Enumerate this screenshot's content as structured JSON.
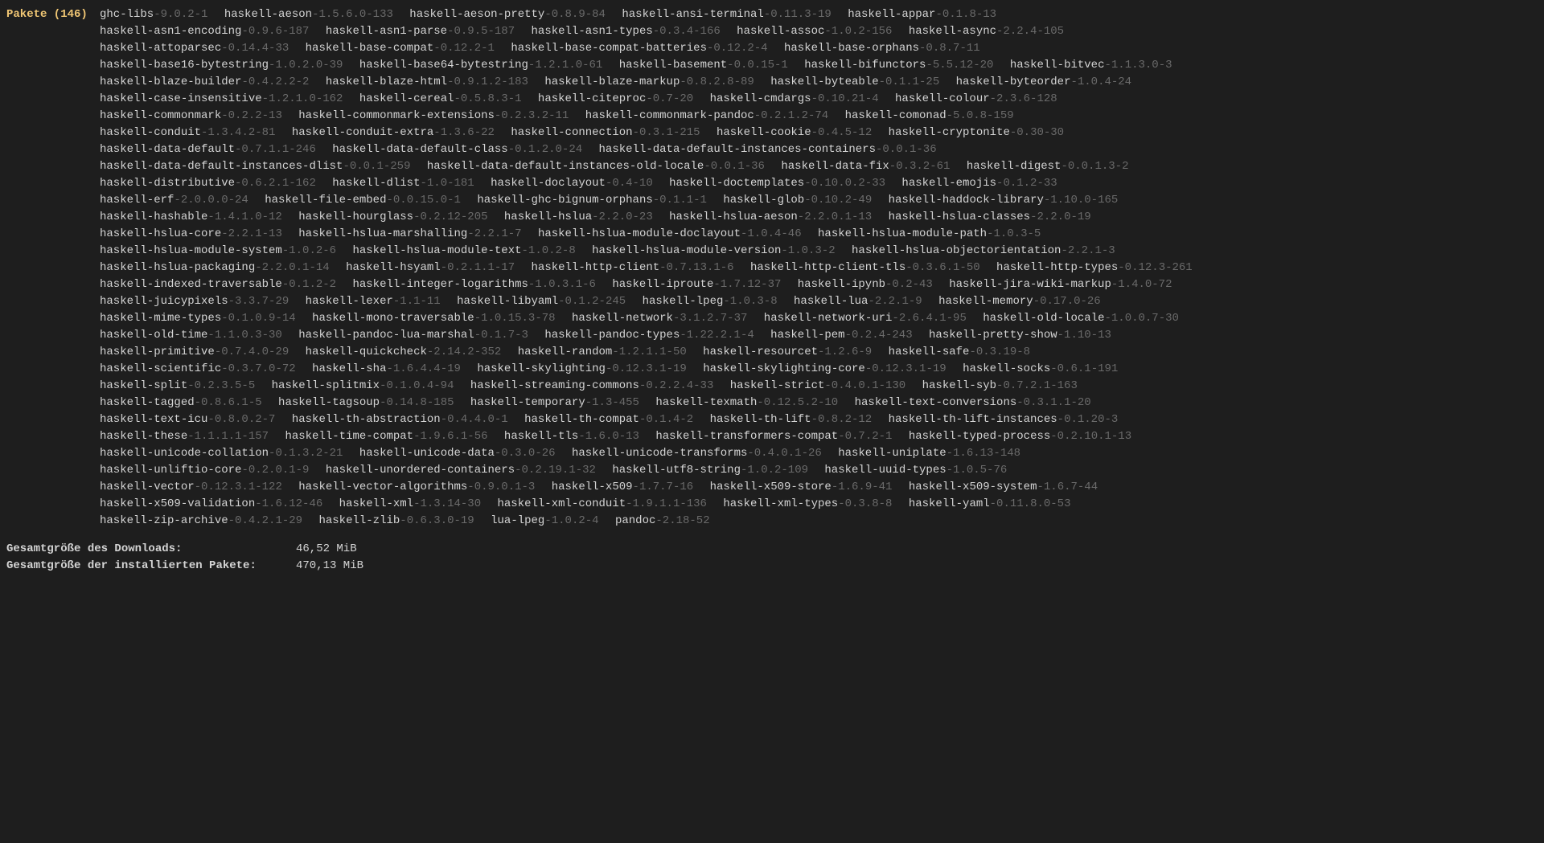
{
  "header": {
    "label": "Pakete",
    "count": "146"
  },
  "packages": [
    {
      "name": "ghc-libs",
      "ver": "9.0.2-1"
    },
    {
      "name": "haskell-aeson",
      "ver": "1.5.6.0-133"
    },
    {
      "name": "haskell-aeson-pretty",
      "ver": "0.8.9-84"
    },
    {
      "name": "haskell-ansi-terminal",
      "ver": "0.11.3-19"
    },
    {
      "name": "haskell-appar",
      "ver": "0.1.8-13"
    },
    {
      "name": "haskell-asn1-encoding",
      "ver": "0.9.6-187"
    },
    {
      "name": "haskell-asn1-parse",
      "ver": "0.9.5-187"
    },
    {
      "name": "haskell-asn1-types",
      "ver": "0.3.4-166"
    },
    {
      "name": "haskell-assoc",
      "ver": "1.0.2-156"
    },
    {
      "name": "haskell-async",
      "ver": "2.2.4-105"
    },
    {
      "name": "haskell-attoparsec",
      "ver": "0.14.4-33"
    },
    {
      "name": "haskell-base-compat",
      "ver": "0.12.2-1"
    },
    {
      "name": "haskell-base-compat-batteries",
      "ver": "0.12.2-4"
    },
    {
      "name": "haskell-base-orphans",
      "ver": "0.8.7-11"
    },
    {
      "name": "haskell-base16-bytestring",
      "ver": "1.0.2.0-39"
    },
    {
      "name": "haskell-base64-bytestring",
      "ver": "1.2.1.0-61"
    },
    {
      "name": "haskell-basement",
      "ver": "0.0.15-1"
    },
    {
      "name": "haskell-bifunctors",
      "ver": "5.5.12-20"
    },
    {
      "name": "haskell-bitvec",
      "ver": "1.1.3.0-3"
    },
    {
      "name": "haskell-blaze-builder",
      "ver": "0.4.2.2-2"
    },
    {
      "name": "haskell-blaze-html",
      "ver": "0.9.1.2-183"
    },
    {
      "name": "haskell-blaze-markup",
      "ver": "0.8.2.8-89"
    },
    {
      "name": "haskell-byteable",
      "ver": "0.1.1-25"
    },
    {
      "name": "haskell-byteorder",
      "ver": "1.0.4-24"
    },
    {
      "name": "haskell-case-insensitive",
      "ver": "1.2.1.0-162"
    },
    {
      "name": "haskell-cereal",
      "ver": "0.5.8.3-1"
    },
    {
      "name": "haskell-citeproc",
      "ver": "0.7-20"
    },
    {
      "name": "haskell-cmdargs",
      "ver": "0.10.21-4"
    },
    {
      "name": "haskell-colour",
      "ver": "2.3.6-128"
    },
    {
      "name": "haskell-commonmark",
      "ver": "0.2.2-13"
    },
    {
      "name": "haskell-commonmark-extensions",
      "ver": "0.2.3.2-11"
    },
    {
      "name": "haskell-commonmark-pandoc",
      "ver": "0.2.1.2-74"
    },
    {
      "name": "haskell-comonad",
      "ver": "5.0.8-159"
    },
    {
      "name": "haskell-conduit",
      "ver": "1.3.4.2-81"
    },
    {
      "name": "haskell-conduit-extra",
      "ver": "1.3.6-22"
    },
    {
      "name": "haskell-connection",
      "ver": "0.3.1-215"
    },
    {
      "name": "haskell-cookie",
      "ver": "0.4.5-12"
    },
    {
      "name": "haskell-cryptonite",
      "ver": "0.30-30"
    },
    {
      "name": "haskell-data-default",
      "ver": "0.7.1.1-246"
    },
    {
      "name": "haskell-data-default-class",
      "ver": "0.1.2.0-24"
    },
    {
      "name": "haskell-data-default-instances-containers",
      "ver": "0.0.1-36"
    },
    {
      "name": "haskell-data-default-instances-dlist",
      "ver": "0.0.1-259"
    },
    {
      "name": "haskell-data-default-instances-old-locale",
      "ver": "0.0.1-36"
    },
    {
      "name": "haskell-data-fix",
      "ver": "0.3.2-61"
    },
    {
      "name": "haskell-digest",
      "ver": "0.0.1.3-2"
    },
    {
      "name": "haskell-distributive",
      "ver": "0.6.2.1-162"
    },
    {
      "name": "haskell-dlist",
      "ver": "1.0-181"
    },
    {
      "name": "haskell-doclayout",
      "ver": "0.4-10"
    },
    {
      "name": "haskell-doctemplates",
      "ver": "0.10.0.2-33"
    },
    {
      "name": "haskell-emojis",
      "ver": "0.1.2-33"
    },
    {
      "name": "haskell-erf",
      "ver": "2.0.0.0-24"
    },
    {
      "name": "haskell-file-embed",
      "ver": "0.0.15.0-1"
    },
    {
      "name": "haskell-ghc-bignum-orphans",
      "ver": "0.1.1-1"
    },
    {
      "name": "haskell-glob",
      "ver": "0.10.2-49"
    },
    {
      "name": "haskell-haddock-library",
      "ver": "1.10.0-165"
    },
    {
      "name": "haskell-hashable",
      "ver": "1.4.1.0-12"
    },
    {
      "name": "haskell-hourglass",
      "ver": "0.2.12-205"
    },
    {
      "name": "haskell-hslua",
      "ver": "2.2.0-23"
    },
    {
      "name": "haskell-hslua-aeson",
      "ver": "2.2.0.1-13"
    },
    {
      "name": "haskell-hslua-classes",
      "ver": "2.2.0-19"
    },
    {
      "name": "haskell-hslua-core",
      "ver": "2.2.1-13"
    },
    {
      "name": "haskell-hslua-marshalling",
      "ver": "2.2.1-7"
    },
    {
      "name": "haskell-hslua-module-doclayout",
      "ver": "1.0.4-46"
    },
    {
      "name": "haskell-hslua-module-path",
      "ver": "1.0.3-5"
    },
    {
      "name": "haskell-hslua-module-system",
      "ver": "1.0.2-6"
    },
    {
      "name": "haskell-hslua-module-text",
      "ver": "1.0.2-8"
    },
    {
      "name": "haskell-hslua-module-version",
      "ver": "1.0.3-2"
    },
    {
      "name": "haskell-hslua-objectorientation",
      "ver": "2.2.1-3"
    },
    {
      "name": "haskell-hslua-packaging",
      "ver": "2.2.0.1-14"
    },
    {
      "name": "haskell-hsyaml",
      "ver": "0.2.1.1-17"
    },
    {
      "name": "haskell-http-client",
      "ver": "0.7.13.1-6"
    },
    {
      "name": "haskell-http-client-tls",
      "ver": "0.3.6.1-50"
    },
    {
      "name": "haskell-http-types",
      "ver": "0.12.3-261"
    },
    {
      "name": "haskell-indexed-traversable",
      "ver": "0.1.2-2"
    },
    {
      "name": "haskell-integer-logarithms",
      "ver": "1.0.3.1-6"
    },
    {
      "name": "haskell-iproute",
      "ver": "1.7.12-37"
    },
    {
      "name": "haskell-ipynb",
      "ver": "0.2-43"
    },
    {
      "name": "haskell-jira-wiki-markup",
      "ver": "1.4.0-72"
    },
    {
      "name": "haskell-juicypixels",
      "ver": "3.3.7-29"
    },
    {
      "name": "haskell-lexer",
      "ver": "1.1-11"
    },
    {
      "name": "haskell-libyaml",
      "ver": "0.1.2-245"
    },
    {
      "name": "haskell-lpeg",
      "ver": "1.0.3-8"
    },
    {
      "name": "haskell-lua",
      "ver": "2.2.1-9"
    },
    {
      "name": "haskell-memory",
      "ver": "0.17.0-26"
    },
    {
      "name": "haskell-mime-types",
      "ver": "0.1.0.9-14"
    },
    {
      "name": "haskell-mono-traversable",
      "ver": "1.0.15.3-78"
    },
    {
      "name": "haskell-network",
      "ver": "3.1.2.7-37"
    },
    {
      "name": "haskell-network-uri",
      "ver": "2.6.4.1-95"
    },
    {
      "name": "haskell-old-locale",
      "ver": "1.0.0.7-30"
    },
    {
      "name": "haskell-old-time",
      "ver": "1.1.0.3-30"
    },
    {
      "name": "haskell-pandoc-lua-marshal",
      "ver": "0.1.7-3"
    },
    {
      "name": "haskell-pandoc-types",
      "ver": "1.22.2.1-4"
    },
    {
      "name": "haskell-pem",
      "ver": "0.2.4-243"
    },
    {
      "name": "haskell-pretty-show",
      "ver": "1.10-13"
    },
    {
      "name": "haskell-primitive",
      "ver": "0.7.4.0-29"
    },
    {
      "name": "haskell-quickcheck",
      "ver": "2.14.2-352"
    },
    {
      "name": "haskell-random",
      "ver": "1.2.1.1-50"
    },
    {
      "name": "haskell-resourcet",
      "ver": "1.2.6-9"
    },
    {
      "name": "haskell-safe",
      "ver": "0.3.19-8"
    },
    {
      "name": "haskell-scientific",
      "ver": "0.3.7.0-72"
    },
    {
      "name": "haskell-sha",
      "ver": "1.6.4.4-19"
    },
    {
      "name": "haskell-skylighting",
      "ver": "0.12.3.1-19"
    },
    {
      "name": "haskell-skylighting-core",
      "ver": "0.12.3.1-19"
    },
    {
      "name": "haskell-socks",
      "ver": "0.6.1-191"
    },
    {
      "name": "haskell-split",
      "ver": "0.2.3.5-5"
    },
    {
      "name": "haskell-splitmix",
      "ver": "0.1.0.4-94"
    },
    {
      "name": "haskell-streaming-commons",
      "ver": "0.2.2.4-33"
    },
    {
      "name": "haskell-strict",
      "ver": "0.4.0.1-130"
    },
    {
      "name": "haskell-syb",
      "ver": "0.7.2.1-163"
    },
    {
      "name": "haskell-tagged",
      "ver": "0.8.6.1-5"
    },
    {
      "name": "haskell-tagsoup",
      "ver": "0.14.8-185"
    },
    {
      "name": "haskell-temporary",
      "ver": "1.3-455"
    },
    {
      "name": "haskell-texmath",
      "ver": "0.12.5.2-10"
    },
    {
      "name": "haskell-text-conversions",
      "ver": "0.3.1.1-20"
    },
    {
      "name": "haskell-text-icu",
      "ver": "0.8.0.2-7"
    },
    {
      "name": "haskell-th-abstraction",
      "ver": "0.4.4.0-1"
    },
    {
      "name": "haskell-th-compat",
      "ver": "0.1.4-2"
    },
    {
      "name": "haskell-th-lift",
      "ver": "0.8.2-12"
    },
    {
      "name": "haskell-th-lift-instances",
      "ver": "0.1.20-3"
    },
    {
      "name": "haskell-these",
      "ver": "1.1.1.1-157"
    },
    {
      "name": "haskell-time-compat",
      "ver": "1.9.6.1-56"
    },
    {
      "name": "haskell-tls",
      "ver": "1.6.0-13"
    },
    {
      "name": "haskell-transformers-compat",
      "ver": "0.7.2-1"
    },
    {
      "name": "haskell-typed-process",
      "ver": "0.2.10.1-13"
    },
    {
      "name": "haskell-unicode-collation",
      "ver": "0.1.3.2-21"
    },
    {
      "name": "haskell-unicode-data",
      "ver": "0.3.0-26"
    },
    {
      "name": "haskell-unicode-transforms",
      "ver": "0.4.0.1-26"
    },
    {
      "name": "haskell-uniplate",
      "ver": "1.6.13-148"
    },
    {
      "name": "haskell-unliftio-core",
      "ver": "0.2.0.1-9"
    },
    {
      "name": "haskell-unordered-containers",
      "ver": "0.2.19.1-32"
    },
    {
      "name": "haskell-utf8-string",
      "ver": "1.0.2-109"
    },
    {
      "name": "haskell-uuid-types",
      "ver": "1.0.5-76"
    },
    {
      "name": "haskell-vector",
      "ver": "0.12.3.1-122"
    },
    {
      "name": "haskell-vector-algorithms",
      "ver": "0.9.0.1-3"
    },
    {
      "name": "haskell-x509",
      "ver": "1.7.7-16"
    },
    {
      "name": "haskell-x509-store",
      "ver": "1.6.9-41"
    },
    {
      "name": "haskell-x509-system",
      "ver": "1.6.7-44"
    },
    {
      "name": "haskell-x509-validation",
      "ver": "1.6.12-46"
    },
    {
      "name": "haskell-xml",
      "ver": "1.3.14-30"
    },
    {
      "name": "haskell-xml-conduit",
      "ver": "1.9.1.1-136"
    },
    {
      "name": "haskell-xml-types",
      "ver": "0.3.8-8"
    },
    {
      "name": "haskell-yaml",
      "ver": "0.11.8.0-53"
    },
    {
      "name": "haskell-zip-archive",
      "ver": "0.4.2.1-29"
    },
    {
      "name": "haskell-zlib",
      "ver": "0.6.3.0-19"
    },
    {
      "name": "lua-lpeg",
      "ver": "1.0.2-4"
    },
    {
      "name": "pandoc",
      "ver": "2.18-52"
    }
  ],
  "summary": {
    "download_label": "Gesamtgröße des Downloads:",
    "download_value": "46,52 MiB",
    "installed_label": "Gesamtgröße der installierten Pakete:",
    "installed_value": "470,13 MiB"
  }
}
